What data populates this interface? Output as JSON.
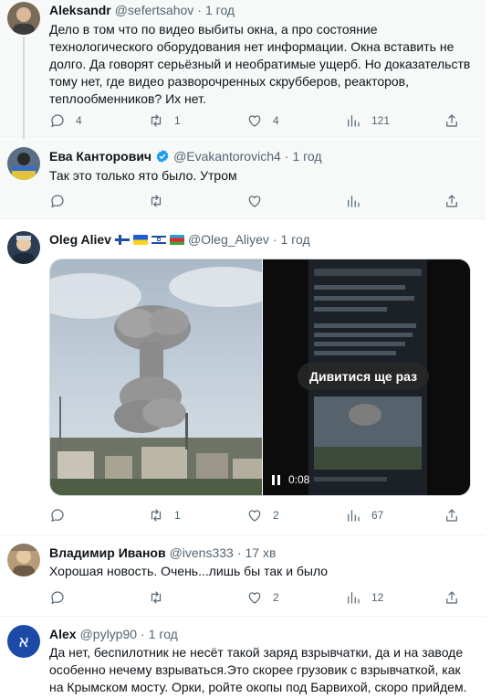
{
  "tweets": [
    {
      "name": "Aleksandr",
      "handle": "@sefertsahov",
      "dot": "·",
      "time": "1 год",
      "text": "Дело в том что по видео выбиты окна, а про состояние технологического оборудования нет информации. Окна вставить не долго. Да говорят серьёзный и необратимые ущерб. Но доказательств тому нет, где видео разворочренных скрубберов, реакторов, теплообменников? Их нет.",
      "replies": "4",
      "retweets": "1",
      "likes": "4",
      "views": "121"
    },
    {
      "name": "Ева Канторович",
      "handle": "@Evakantorovich4",
      "dot": "·",
      "time": "1 год",
      "text": "Так это только ято было. Утром",
      "replies": "",
      "retweets": "",
      "likes": "",
      "views": ""
    },
    {
      "name": "Oleg Aliev",
      "handle": "@Oleg_Aliyev",
      "dot": "·",
      "time": "1 год",
      "media_replay_label": "Дивитися ще раз",
      "media_time": "0:08",
      "replies": "",
      "retweets": "1",
      "likes": "2",
      "views": "67"
    },
    {
      "name": "Владимир Иванов",
      "handle": "@ivens333",
      "dot": "·",
      "time": "17 хв",
      "text": "Хорошая новость. Очень...лишь бы так и было",
      "replies": "",
      "retweets": "",
      "likes": "2",
      "views": "12"
    },
    {
      "name": "Alex",
      "handle": "@pylyp90",
      "dot": "·",
      "time": "1 год",
      "text": "Да нет, беспилотник не несёт такой заряд взрывчатки, да и на заводе особенно нечему взрываться.Это скорее грузовик с взрывчаткой, как на Крымском мосту.  Орки, ройте окопы под Барвихой, скоро прийдем.",
      "avatar_letter": "א"
    }
  ],
  "colors": {
    "verified": "#1d9bf0",
    "text": "#0f1419",
    "muted": "#536471",
    "alex_avatar": "#1d4aa7"
  },
  "icons": [
    "reply-icon",
    "retweet-icon",
    "like-icon",
    "views-icon",
    "share-icon",
    "verified-icon",
    "play-pause-icon"
  ]
}
